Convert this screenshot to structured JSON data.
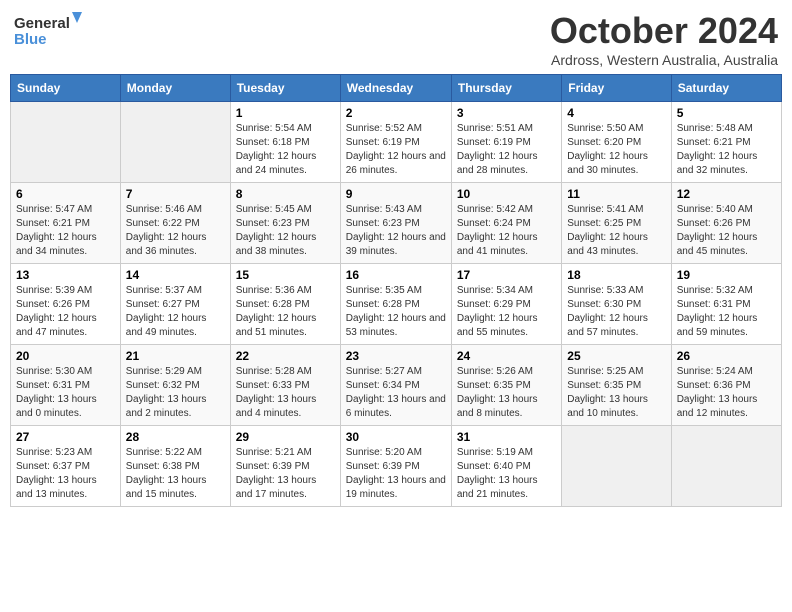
{
  "header": {
    "logo_line1": "General",
    "logo_line2": "Blue",
    "month_year": "October 2024",
    "location": "Ardross, Western Australia, Australia"
  },
  "columns": [
    "Sunday",
    "Monday",
    "Tuesday",
    "Wednesday",
    "Thursday",
    "Friday",
    "Saturday"
  ],
  "weeks": [
    [
      {
        "day": "",
        "sunrise": "",
        "sunset": "",
        "daylight": ""
      },
      {
        "day": "",
        "sunrise": "",
        "sunset": "",
        "daylight": ""
      },
      {
        "day": "1",
        "sunrise": "Sunrise: 5:54 AM",
        "sunset": "Sunset: 6:18 PM",
        "daylight": "Daylight: 12 hours and 24 minutes."
      },
      {
        "day": "2",
        "sunrise": "Sunrise: 5:52 AM",
        "sunset": "Sunset: 6:19 PM",
        "daylight": "Daylight: 12 hours and 26 minutes."
      },
      {
        "day": "3",
        "sunrise": "Sunrise: 5:51 AM",
        "sunset": "Sunset: 6:19 PM",
        "daylight": "Daylight: 12 hours and 28 minutes."
      },
      {
        "day": "4",
        "sunrise": "Sunrise: 5:50 AM",
        "sunset": "Sunset: 6:20 PM",
        "daylight": "Daylight: 12 hours and 30 minutes."
      },
      {
        "day": "5",
        "sunrise": "Sunrise: 5:48 AM",
        "sunset": "Sunset: 6:21 PM",
        "daylight": "Daylight: 12 hours and 32 minutes."
      }
    ],
    [
      {
        "day": "6",
        "sunrise": "Sunrise: 5:47 AM",
        "sunset": "Sunset: 6:21 PM",
        "daylight": "Daylight: 12 hours and 34 minutes."
      },
      {
        "day": "7",
        "sunrise": "Sunrise: 5:46 AM",
        "sunset": "Sunset: 6:22 PM",
        "daylight": "Daylight: 12 hours and 36 minutes."
      },
      {
        "day": "8",
        "sunrise": "Sunrise: 5:45 AM",
        "sunset": "Sunset: 6:23 PM",
        "daylight": "Daylight: 12 hours and 38 minutes."
      },
      {
        "day": "9",
        "sunrise": "Sunrise: 5:43 AM",
        "sunset": "Sunset: 6:23 PM",
        "daylight": "Daylight: 12 hours and 39 minutes."
      },
      {
        "day": "10",
        "sunrise": "Sunrise: 5:42 AM",
        "sunset": "Sunset: 6:24 PM",
        "daylight": "Daylight: 12 hours and 41 minutes."
      },
      {
        "day": "11",
        "sunrise": "Sunrise: 5:41 AM",
        "sunset": "Sunset: 6:25 PM",
        "daylight": "Daylight: 12 hours and 43 minutes."
      },
      {
        "day": "12",
        "sunrise": "Sunrise: 5:40 AM",
        "sunset": "Sunset: 6:26 PM",
        "daylight": "Daylight: 12 hours and 45 minutes."
      }
    ],
    [
      {
        "day": "13",
        "sunrise": "Sunrise: 5:39 AM",
        "sunset": "Sunset: 6:26 PM",
        "daylight": "Daylight: 12 hours and 47 minutes."
      },
      {
        "day": "14",
        "sunrise": "Sunrise: 5:37 AM",
        "sunset": "Sunset: 6:27 PM",
        "daylight": "Daylight: 12 hours and 49 minutes."
      },
      {
        "day": "15",
        "sunrise": "Sunrise: 5:36 AM",
        "sunset": "Sunset: 6:28 PM",
        "daylight": "Daylight: 12 hours and 51 minutes."
      },
      {
        "day": "16",
        "sunrise": "Sunrise: 5:35 AM",
        "sunset": "Sunset: 6:28 PM",
        "daylight": "Daylight: 12 hours and 53 minutes."
      },
      {
        "day": "17",
        "sunrise": "Sunrise: 5:34 AM",
        "sunset": "Sunset: 6:29 PM",
        "daylight": "Daylight: 12 hours and 55 minutes."
      },
      {
        "day": "18",
        "sunrise": "Sunrise: 5:33 AM",
        "sunset": "Sunset: 6:30 PM",
        "daylight": "Daylight: 12 hours and 57 minutes."
      },
      {
        "day": "19",
        "sunrise": "Sunrise: 5:32 AM",
        "sunset": "Sunset: 6:31 PM",
        "daylight": "Daylight: 12 hours and 59 minutes."
      }
    ],
    [
      {
        "day": "20",
        "sunrise": "Sunrise: 5:30 AM",
        "sunset": "Sunset: 6:31 PM",
        "daylight": "Daylight: 13 hours and 0 minutes."
      },
      {
        "day": "21",
        "sunrise": "Sunrise: 5:29 AM",
        "sunset": "Sunset: 6:32 PM",
        "daylight": "Daylight: 13 hours and 2 minutes."
      },
      {
        "day": "22",
        "sunrise": "Sunrise: 5:28 AM",
        "sunset": "Sunset: 6:33 PM",
        "daylight": "Daylight: 13 hours and 4 minutes."
      },
      {
        "day": "23",
        "sunrise": "Sunrise: 5:27 AM",
        "sunset": "Sunset: 6:34 PM",
        "daylight": "Daylight: 13 hours and 6 minutes."
      },
      {
        "day": "24",
        "sunrise": "Sunrise: 5:26 AM",
        "sunset": "Sunset: 6:35 PM",
        "daylight": "Daylight: 13 hours and 8 minutes."
      },
      {
        "day": "25",
        "sunrise": "Sunrise: 5:25 AM",
        "sunset": "Sunset: 6:35 PM",
        "daylight": "Daylight: 13 hours and 10 minutes."
      },
      {
        "day": "26",
        "sunrise": "Sunrise: 5:24 AM",
        "sunset": "Sunset: 6:36 PM",
        "daylight": "Daylight: 13 hours and 12 minutes."
      }
    ],
    [
      {
        "day": "27",
        "sunrise": "Sunrise: 5:23 AM",
        "sunset": "Sunset: 6:37 PM",
        "daylight": "Daylight: 13 hours and 13 minutes."
      },
      {
        "day": "28",
        "sunrise": "Sunrise: 5:22 AM",
        "sunset": "Sunset: 6:38 PM",
        "daylight": "Daylight: 13 hours and 15 minutes."
      },
      {
        "day": "29",
        "sunrise": "Sunrise: 5:21 AM",
        "sunset": "Sunset: 6:39 PM",
        "daylight": "Daylight: 13 hours and 17 minutes."
      },
      {
        "day": "30",
        "sunrise": "Sunrise: 5:20 AM",
        "sunset": "Sunset: 6:39 PM",
        "daylight": "Daylight: 13 hours and 19 minutes."
      },
      {
        "day": "31",
        "sunrise": "Sunrise: 5:19 AM",
        "sunset": "Sunset: 6:40 PM",
        "daylight": "Daylight: 13 hours and 21 minutes."
      },
      {
        "day": "",
        "sunrise": "",
        "sunset": "",
        "daylight": ""
      },
      {
        "day": "",
        "sunrise": "",
        "sunset": "",
        "daylight": ""
      }
    ]
  ]
}
